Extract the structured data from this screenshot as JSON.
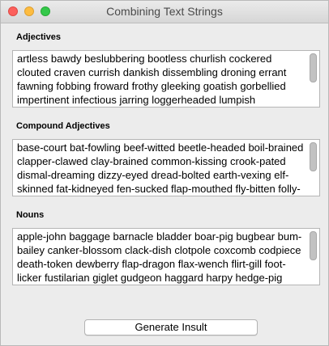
{
  "window": {
    "title": "Combining Text Strings"
  },
  "sections": [
    {
      "label": "Adjectives",
      "text": "artless bawdy beslubbering bootless churlish cockered clouted craven currish dankish dissembling droning errant fawning fobbing froward frothy gleeking goatish gorbellied impertinent infectious jarring loggerheaded lumpish mammering mangled mewling paunchy pribbling puking"
    },
    {
      "label": "Compound Adjectives",
      "text": "base-court bat-fowling beef-witted beetle-headed boil-brained clapper-clawed clay-brained common-kissing crook-pated dismal-dreaming dizzy-eyed dread-bolted earth-vexing elf-skinned fat-kidneyed fen-sucked flap-mouthed fly-bitten folly-fallen fool-born full-gorged"
    },
    {
      "label": "Nouns",
      "text": "apple-john baggage barnacle bladder boar-pig bugbear bum-bailey canker-blossom clack-dish clotpole coxcomb codpiece death-token dewberry flap-dragon flax-wench flirt-gill foot-licker fustilarian giglet gudgeon haggard harpy hedge-pig horn-beast hugger-mugger joithead lewdster lout"
    }
  ],
  "generate_button": {
    "label": "Generate Insult"
  }
}
